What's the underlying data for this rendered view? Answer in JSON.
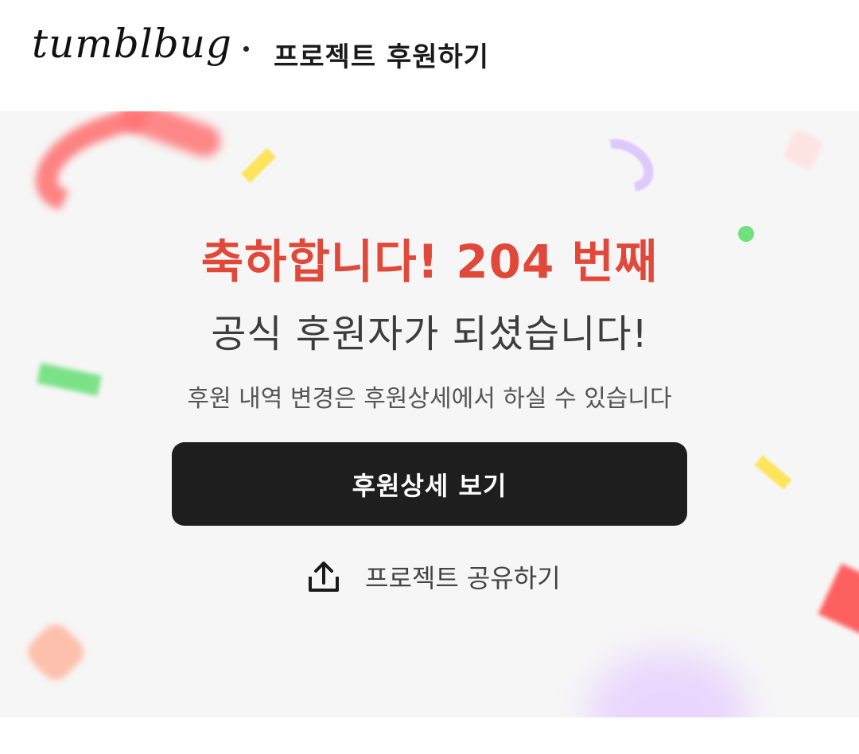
{
  "header": {
    "logo_text": "tumblbug",
    "title": "프로젝트 후원하기"
  },
  "hero": {
    "headline": "축하합니다! 204 번째",
    "subline": "공식 후원자가 되셨습니다!",
    "caption": "후원 내역 변경은 후원상세에서 하실 수 있습니다",
    "detail_button_label": "후원상세 보기",
    "share_label": "프로젝트 공유하기",
    "share_icon": "share-upload-icon"
  },
  "colors": {
    "headline": "#e0493a",
    "button_bg": "#1e1e1e",
    "hero_bg": "#f6f6f6"
  }
}
